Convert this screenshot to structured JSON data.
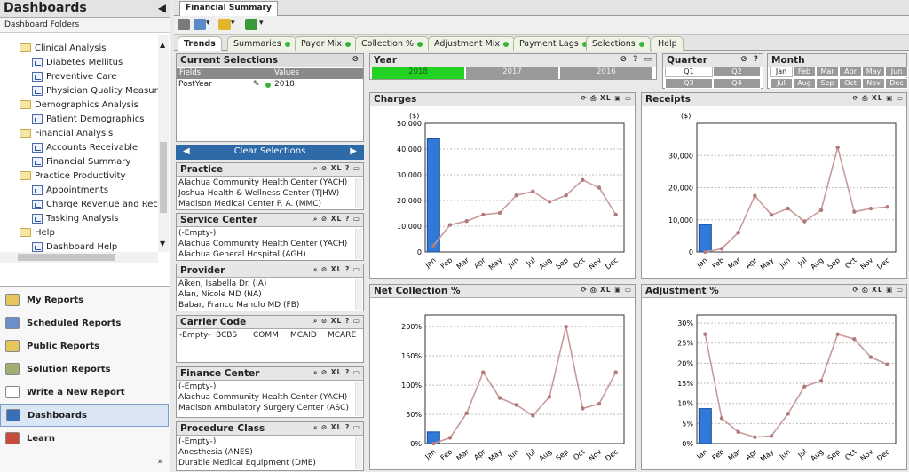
{
  "sidebar": {
    "title": "Dashboards",
    "collapse_glyph": "◀",
    "folders_label": "Dashboard Folders",
    "tree": [
      {
        "label": "Clinical Analysis",
        "type": "folder",
        "indent": 0
      },
      {
        "label": "Diabetes Mellitus",
        "type": "report",
        "indent": 1
      },
      {
        "label": "Preventive Care",
        "type": "report",
        "indent": 1
      },
      {
        "label": "Physician Quality Measures",
        "type": "report",
        "indent": 1
      },
      {
        "label": "Demographics Analysis",
        "type": "folder",
        "indent": 0
      },
      {
        "label": "Patient Demographics",
        "type": "report",
        "indent": 1
      },
      {
        "label": "Financial Analysis",
        "type": "folder",
        "indent": 0
      },
      {
        "label": "Accounts Receivable",
        "type": "report",
        "indent": 1
      },
      {
        "label": "Financial Summary",
        "type": "report",
        "indent": 1
      },
      {
        "label": "Practice Productivity",
        "type": "folder",
        "indent": 0
      },
      {
        "label": "Appointments",
        "type": "report",
        "indent": 1
      },
      {
        "label": "Charge Revenue and Rece",
        "type": "report",
        "indent": 1
      },
      {
        "label": "Tasking Analysis",
        "type": "report",
        "indent": 1
      },
      {
        "label": "Help",
        "type": "folder",
        "indent": 0
      },
      {
        "label": "Dashboard Help",
        "type": "report",
        "indent": 1
      }
    ],
    "nav": [
      {
        "label": "My Reports",
        "icon": "folder-icon",
        "color": "#e6c65a",
        "active": false
      },
      {
        "label": "Scheduled Reports",
        "icon": "clock-icon",
        "color": "#6a8fc9",
        "active": false
      },
      {
        "label": "Public Reports",
        "icon": "folder-icon",
        "color": "#e6c65a",
        "active": false
      },
      {
        "label": "Solution Reports",
        "icon": "chart-icon",
        "color": "#a0b070",
        "active": false
      },
      {
        "label": "Write a New Report",
        "icon": "document-icon",
        "color": "#ffffff",
        "active": false
      },
      {
        "label": "Dashboards",
        "icon": "dashboard-icon",
        "color": "#3a6fb8",
        "active": true
      },
      {
        "label": "Learn",
        "icon": "books-icon",
        "color": "#c84a3a",
        "active": false
      }
    ],
    "more_glyph": "»"
  },
  "window_tab": "Financial Summary",
  "toolbar_icons": [
    "print-icon",
    "search-icon",
    "star-icon",
    "excel-icon"
  ],
  "sheet_tabs": [
    {
      "label": "Trends",
      "active": true,
      "dot": false
    },
    {
      "label": "Summaries",
      "active": false,
      "dot": true
    },
    {
      "label": "Payer Mix",
      "active": false,
      "dot": true
    },
    {
      "label": "Collection %",
      "active": false,
      "dot": true
    },
    {
      "label": "Adjustment Mix",
      "active": false,
      "dot": true
    },
    {
      "label": "Payment Lags",
      "active": false,
      "dot": true
    },
    {
      "label": "Selections",
      "active": false,
      "dot": true
    },
    {
      "label": "Help",
      "active": false,
      "dot": false
    }
  ],
  "current_selections": {
    "title": "Current Selections",
    "col_fields": "Fields",
    "col_values": "Values",
    "field": "PostYear",
    "value": "2018",
    "clear_label": "Clear Selections"
  },
  "listboxes": [
    {
      "title": "Practice",
      "items": [
        "Alachua Community Health Center (YACH)",
        "Joshua Health & Wellness Center (TJHW)",
        "Madison Medical Center P. A. (MMC)"
      ]
    },
    {
      "title": "Service Center",
      "items": [
        "(-Empty-)",
        "Alachua Community Health Center (YACH)",
        "Alachua General Hospital (AGH)"
      ]
    },
    {
      "title": "Provider",
      "items": [
        "Aiken, Isabella Dr. (IA)",
        "Alan, Nicole MD (NA)",
        "Babar, Franco Manolo MD (FB)"
      ]
    },
    {
      "title": "Carrier Code",
      "items": [
        "-Empty-",
        "BCBS",
        "COMM",
        "MCAID",
        "MCARE"
      ]
    },
    {
      "title": "Finance Center",
      "items": [
        "(-Empty-)",
        "Alachua Community Health Center (YACH)",
        "Madison Ambulatory Surgery Center (ASC)"
      ]
    },
    {
      "title": "Procedure Class",
      "items": [
        "(-Empty-)",
        "Anesthesia (ANES)",
        "Durable Medical Equipment (DME)"
      ]
    }
  ],
  "year": {
    "title": "Year",
    "values": [
      "2018",
      "2017",
      "2016"
    ],
    "selected": "2018"
  },
  "quarter": {
    "title": "Quarter",
    "values": [
      "Q1",
      "Q2",
      "Q3",
      "Q4"
    ],
    "selected": "Q1"
  },
  "month": {
    "title": "Month",
    "values": [
      "Jan",
      "Feb",
      "Mar",
      "Apr",
      "May",
      "Jun",
      "Jul",
      "Aug",
      "Sep",
      "Oct",
      "Nov",
      "Dec"
    ],
    "selected": "Jan"
  },
  "chart_header_icons": "XL",
  "box_icons": "XL",
  "chart_data": [
    {
      "id": "charges",
      "type": "bar",
      "title": "Charges",
      "ylabel": "($)",
      "ylim": [
        0,
        50000
      ],
      "yticks": [
        0,
        10000,
        20000,
        30000,
        40000,
        50000
      ],
      "yticklabels": [
        "0",
        "10,000",
        "20,000",
        "30,000",
        "40,000",
        "50,000"
      ],
      "categories": [
        "Jan",
        "Feb",
        "Mar",
        "Apr",
        "May",
        "Jun",
        "Jul",
        "Aug",
        "Sep",
        "Oct",
        "Nov",
        "Dec"
      ],
      "bar": {
        "category": "Jan",
        "value": 44000,
        "color": "#2f7ad8"
      },
      "line": {
        "values": [
          2500,
          10500,
          12000,
          14500,
          15200,
          22000,
          23500,
          19500,
          22000,
          28000,
          25000,
          14500
        ],
        "color": "#c99a9a"
      }
    },
    {
      "id": "receipts",
      "type": "bar",
      "title": "Receipts",
      "ylabel": "($)",
      "ylim": [
        0,
        40000
      ],
      "yticks": [
        0,
        10000,
        20000,
        30000
      ],
      "yticklabels": [
        "0",
        "10,000",
        "20,000",
        "30,000"
      ],
      "categories": [
        "Jan",
        "Feb",
        "Mar",
        "Apr",
        "May",
        "Jun",
        "Jul",
        "Aug",
        "Sep",
        "Oct",
        "Nov",
        "Dec"
      ],
      "bar": {
        "category": "Jan",
        "value": 8500,
        "color": "#2f7ad8"
      },
      "line": {
        "values": [
          0,
          1000,
          6000,
          17500,
          11500,
          13500,
          9500,
          13000,
          32500,
          12500,
          13500,
          14000
        ],
        "color": "#c99a9a"
      }
    },
    {
      "id": "net_collection",
      "type": "bar",
      "title": "Net Collection %",
      "ylabel": "",
      "ylim": [
        0,
        2.2
      ],
      "yticks": [
        0,
        0.5,
        1.0,
        1.5,
        2.0
      ],
      "yticklabels": [
        "0%",
        "50%",
        "100%",
        "150%",
        "200%"
      ],
      "categories": [
        "Jan",
        "Feb",
        "Mar",
        "Apr",
        "May",
        "Jun",
        "Jul",
        "Aug",
        "Sep",
        "Oct",
        "Nov",
        "Dec"
      ],
      "bar": {
        "category": "Jan",
        "value": 0.2,
        "color": "#2f7ad8"
      },
      "line": {
        "values": [
          0.0,
          0.1,
          0.52,
          1.22,
          0.78,
          0.66,
          0.48,
          0.8,
          2.0,
          0.6,
          0.68,
          1.22
        ],
        "color": "#c99a9a"
      }
    },
    {
      "id": "adjustment",
      "type": "bar",
      "title": "Adjustment %",
      "ylabel": "",
      "ylim": [
        0,
        0.32
      ],
      "yticks": [
        0,
        0.05,
        0.1,
        0.15,
        0.2,
        0.25,
        0.3
      ],
      "yticklabels": [
        "0%",
        "5%",
        "10%",
        "15%",
        "20%",
        "25%",
        "30%"
      ],
      "categories": [
        "Jan",
        "Feb",
        "Mar",
        "Apr",
        "May",
        "Jun",
        "Jul",
        "Aug",
        "Sep",
        "Oct",
        "Nov",
        "Dec"
      ],
      "bar": {
        "category": "Jan",
        "value": 0.087,
        "color": "#2f7ad8"
      },
      "line": {
        "values": [
          0.272,
          0.063,
          0.029,
          0.016,
          0.019,
          0.074,
          0.142,
          0.156,
          0.272,
          0.26,
          0.215,
          0.197
        ],
        "color": "#c99a9a"
      }
    }
  ]
}
